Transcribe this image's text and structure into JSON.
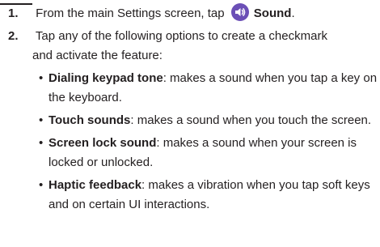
{
  "steps": [
    {
      "number": "1.",
      "text_before": "From the main Settings screen, tap",
      "icon": "sound-icon",
      "icon_color": "#6b4fb6",
      "bold_label": "Sound",
      "text_after": "."
    },
    {
      "number": "2.",
      "line1": "Tap any of the following options to create a checkmark",
      "line2": "and activate the feature:"
    }
  ],
  "options": [
    {
      "bullet": "•",
      "name": "Dialing keypad tone",
      "desc_line1": ": makes a sound when you tap a key on",
      "desc_line2": "the keyboard."
    },
    {
      "bullet": "•",
      "name": "Touch sounds",
      "desc_line1": ": makes a sound when you touch the screen."
    },
    {
      "bullet": "•",
      "name": "Screen lock sound",
      "desc_line1": ": makes a sound when your screen is",
      "desc_line2": "locked or unlocked."
    },
    {
      "bullet": "•",
      "name": "Haptic feedback",
      "desc_line1": ": makes a vibration when you tap soft keys",
      "desc_line2": "and on certain UI interactions."
    }
  ]
}
